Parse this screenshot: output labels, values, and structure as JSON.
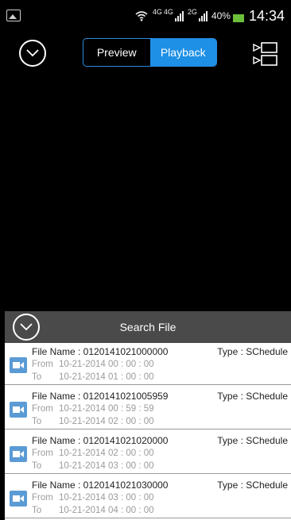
{
  "status_bar": {
    "net_a": "4G",
    "net_b": "4G",
    "net_c": "2G",
    "battery": "40%",
    "time": "14:34"
  },
  "header": {
    "tab_preview": "Preview",
    "tab_playback": "Playback",
    "active_tab": "Playback",
    "accent_color": "#1e90e6"
  },
  "search": {
    "label": "Search File"
  },
  "files": [
    {
      "name": "File Name : 0120141021000000",
      "type": "Type : SChedule",
      "from_label": "From",
      "from": "10-21-2014 00 : 00 : 00",
      "to_label": "To",
      "to": "10-21-2014 01 : 00 : 00"
    },
    {
      "name": "File Name : 0120141021005959",
      "type": "Type : SChedule",
      "from_label": "From",
      "from": "10-21-2014 00 : 59 : 59",
      "to_label": "To",
      "to": "10-21-2014 02 : 00 : 00"
    },
    {
      "name": "File Name : 0120141021020000",
      "type": "Type : SChedule",
      "from_label": "From",
      "from": "10-21-2014 02 : 00 : 00",
      "to_label": "To",
      "to": "10-21-2014 03 : 00 : 00"
    },
    {
      "name": "File Name : 0120141021030000",
      "type": "Type : SChedule",
      "from_label": "From",
      "from": "10-21-2014 03 : 00 : 00",
      "to_label": "To",
      "to": "10-21-2014 04 : 00 : 00"
    }
  ]
}
